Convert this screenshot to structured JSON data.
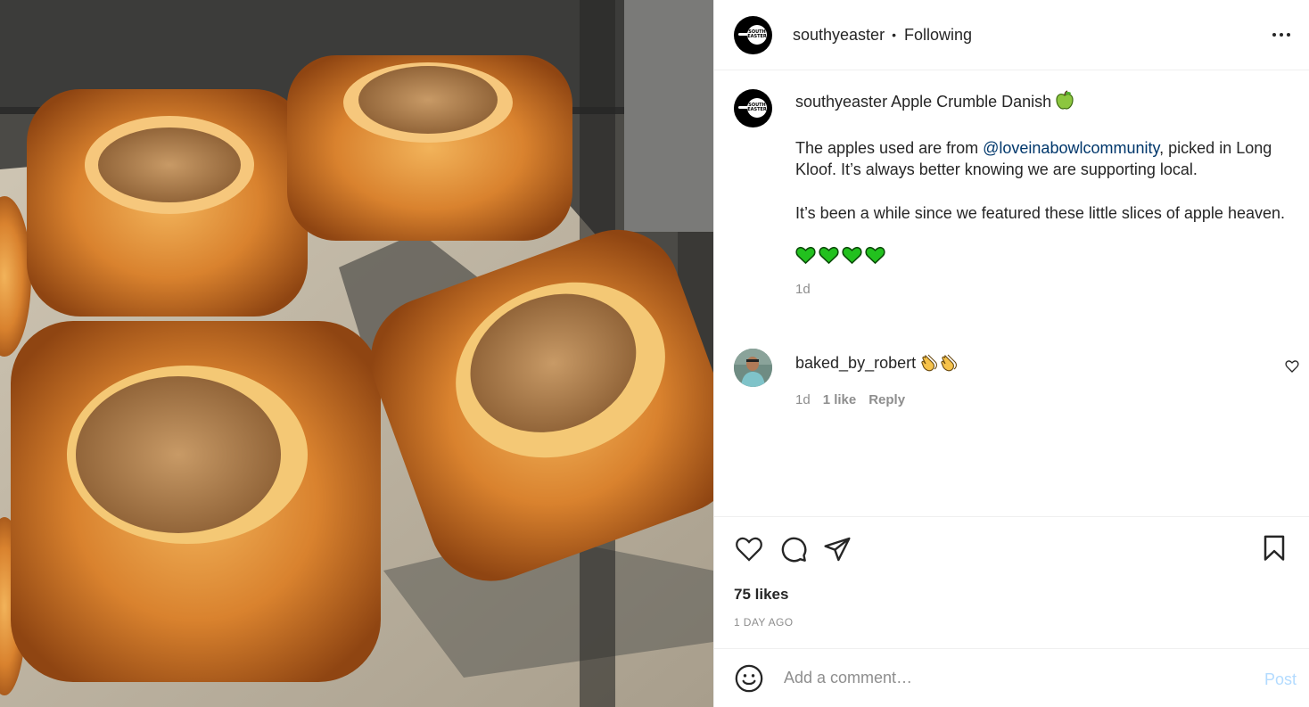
{
  "post": {
    "username": "southyeaster",
    "follow_separator": "•",
    "follow_status": "Following",
    "avatar_text": "SOUTH EASTER"
  },
  "caption": {
    "username": "southyeaster",
    "title": "Apple Crumble Danish",
    "title_emoji": "green-apple-icon",
    "para1_before": "The apples used are from ",
    "mention": "@loveinabowlcommunity",
    "para1_after": ", picked in Long Kloof. It’s always better knowing we are supporting local.",
    "para2": "It’s been a while since we featured these little slices of apple heaven.",
    "hearts_count": 4,
    "time": "1d"
  },
  "comments": [
    {
      "username": "baked_by_robert",
      "emoji": "clapping-hands-icon",
      "time": "1d",
      "likes": "1 like",
      "reply": "Reply"
    }
  ],
  "stats": {
    "likes": "75 likes",
    "posted": "1 DAY AGO"
  },
  "add_comment": {
    "placeholder": "Add a comment…",
    "post_label": "Post"
  },
  "colors": {
    "text": "#262626",
    "secondary": "#8e8e8e",
    "mention": "#00376b",
    "post_button_disabled": "#b3dbff",
    "heart_green": "#22c11e",
    "divider": "#efefef"
  }
}
